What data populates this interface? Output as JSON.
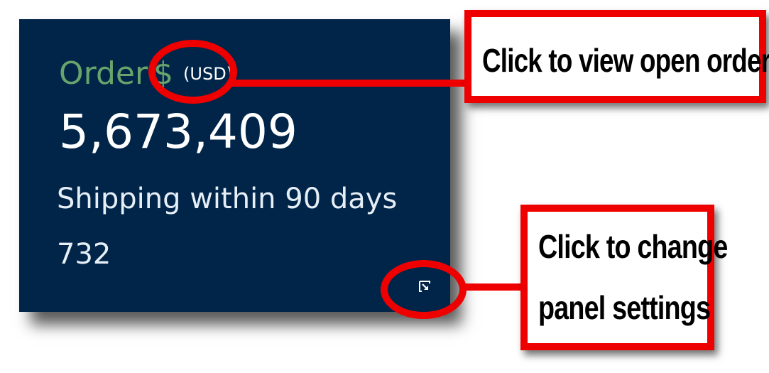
{
  "panel": {
    "title_label": "Order",
    "currency_symbol": "$",
    "currency_unit": "(USD)",
    "order_value": "5,673,409",
    "shipping_label": "Shipping within 90 days",
    "shipping_count": "732",
    "settings_icon": "expand-settings-icon",
    "colors": {
      "background": "#002549",
      "title": "#68a46c",
      "text": "#ffffff"
    }
  },
  "annotations": {
    "open_orders_callout": "Click to view open orders",
    "settings_callout_line1": "Click to change",
    "settings_callout_line2": "panel settings",
    "color": "#ef0000"
  }
}
